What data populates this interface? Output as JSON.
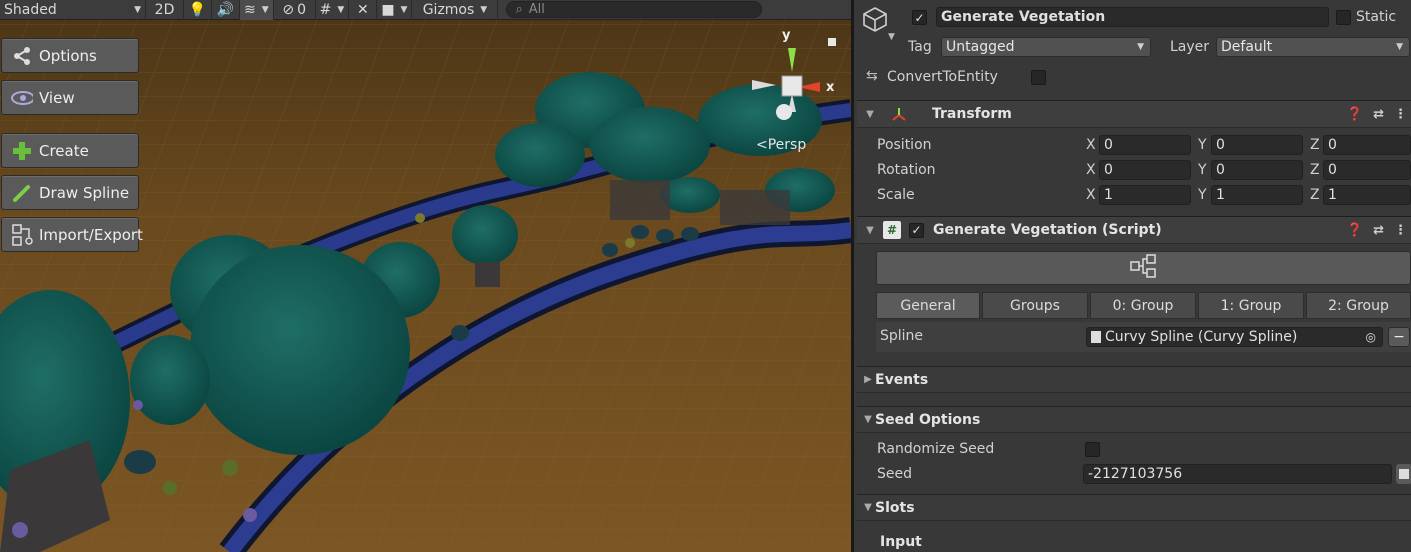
{
  "toolbar": {
    "shading_mode": "Shaded",
    "mode_2d": "2D",
    "hidden_count": "0",
    "gizmos": "Gizmos",
    "search_placeholder": "All"
  },
  "overlay": {
    "options": "Options",
    "view": "View",
    "create": "Create",
    "draw_spline": "Draw Spline",
    "import_export": "Import/Export"
  },
  "gizmo": {
    "y": "y",
    "x": "x",
    "persp": "Persp"
  },
  "inspector": {
    "object_name": "Generate Vegetation",
    "static_label": "Static",
    "tag_label": "Tag",
    "tag_value": "Untagged",
    "layer_label": "Layer",
    "layer_value": "Default",
    "convert_label": "ConvertToEntity",
    "transform": {
      "title": "Transform",
      "position_label": "Position",
      "rotation_label": "Rotation",
      "scale_label": "Scale",
      "axis_x": "X",
      "axis_y": "Y",
      "axis_z": "Z",
      "position": [
        "0",
        "0",
        "0"
      ],
      "rotation": [
        "0",
        "0",
        "0"
      ],
      "scale": [
        "1",
        "1",
        "1"
      ]
    },
    "script": {
      "title": "Generate Vegetation (Script)",
      "tabs": [
        "General",
        "Groups",
        "0: Group",
        "1: Group",
        "2: Group"
      ],
      "spline_label": "Spline",
      "spline_value": "Curvy Spline (Curvy Spline)"
    },
    "events": "Events",
    "seed_options": "Seed Options",
    "randomize_label": "Randomize Seed",
    "seed_label": "Seed",
    "seed_value": "-2127103756",
    "slots": "Slots",
    "input": "Input"
  },
  "colors": {
    "ground": "#6a4a1e",
    "foliage": "#0f5a55",
    "road": "#1c2a6a",
    "panel": "#383838"
  }
}
